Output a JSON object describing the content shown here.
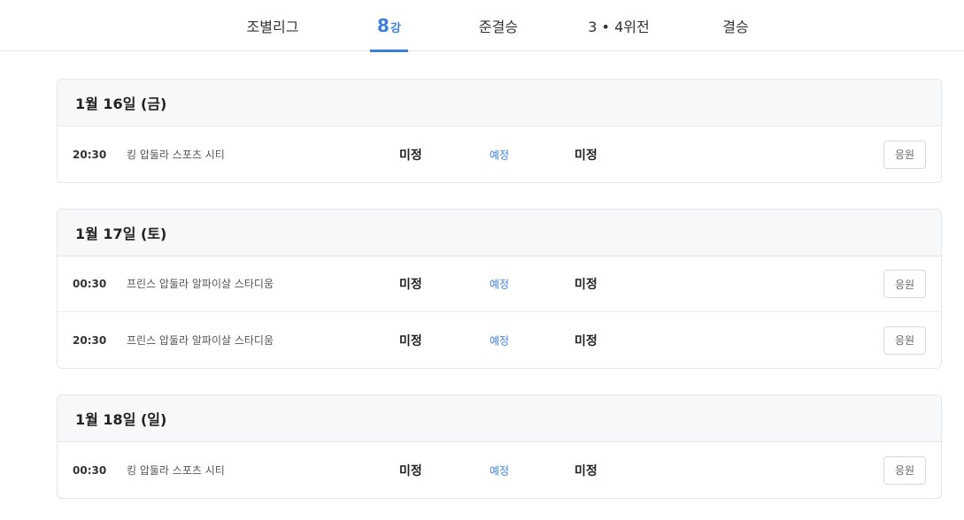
{
  "tabs": [
    {
      "label": "조별리그"
    },
    {
      "label_big": "8",
      "label_small": "강",
      "active": true
    },
    {
      "label": "준결승"
    },
    {
      "label": "3 • 4위전"
    },
    {
      "label": "결승"
    }
  ],
  "days": [
    {
      "date": "1월 16일 (금)",
      "matches": [
        {
          "time": "20:30",
          "venue": "킹 압둘라 스포츠 시티",
          "team1": "미정",
          "status": "예정",
          "team2": "미정",
          "button": "응원"
        }
      ]
    },
    {
      "date": "1월 17일 (토)",
      "matches": [
        {
          "time": "00:30",
          "venue": "프린스 압둘라 알파이살 스타디움",
          "team1": "미정",
          "status": "예정",
          "team2": "미정",
          "button": "응원"
        },
        {
          "time": "20:30",
          "venue": "프린스 압둘라 알파이살 스타디움",
          "team1": "미정",
          "status": "예정",
          "team2": "미정",
          "button": "응원"
        }
      ]
    },
    {
      "date": "1월 18일 (일)",
      "matches": [
        {
          "time": "00:30",
          "venue": "킹 압둘라 스포츠 시티",
          "team1": "미정",
          "status": "예정",
          "team2": "미정",
          "button": "응원"
        }
      ]
    }
  ],
  "colors": {
    "accent": "#3a7fe0",
    "header_bg": "#f7f8fa",
    "border": "#e4e6ea"
  }
}
